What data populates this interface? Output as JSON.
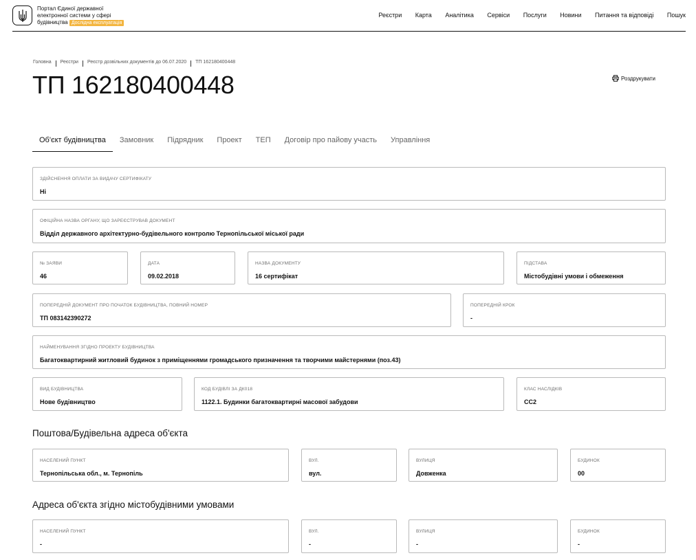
{
  "header": {
    "brand_line1": "Портал Єдиної державної",
    "brand_line2": "електронної системи у сфері",
    "brand_line3": "будівництва",
    "badge": "Дослідна експлуатація",
    "nav": [
      "Реєстри",
      "Карта",
      "Аналітика",
      "Сервіси",
      "Послуги",
      "Новини",
      "Питання та відповіді",
      "Пошук"
    ]
  },
  "breadcrumb": [
    "Головна",
    "Реєстри",
    "Реєстр дозвільних документів до 06.07.2020",
    "ТП 162180400448"
  ],
  "title": "ТП 162180400448",
  "print_label": "Роздрукувати",
  "tabs": [
    "Об'єкт будівництва",
    "Замовник",
    "Підрядник",
    "Проект",
    "ТЕП",
    "Договір про пайову участь",
    "Управління"
  ],
  "active_tab": 0,
  "fields": {
    "payment": {
      "label": "Здійснення оплати за видачу сертифікату",
      "value": "Ні"
    },
    "authority": {
      "label": "Офіційна назва органу, що зареєстрував документ",
      "value": "Відділ державного архітектурно-будівельного контролю Тернопільської міської ради"
    },
    "app_no": {
      "label": "№ заяви",
      "value": "46"
    },
    "date": {
      "label": "Дата",
      "value": "09.02.2018"
    },
    "doc_name": {
      "label": "Назва документу",
      "value": "16 сертифікат"
    },
    "basis": {
      "label": "Підстава",
      "value": "Містобудівні умови і обмеження"
    },
    "prev_doc": {
      "label": "Попередній документ про початок будівництва, повний номер",
      "value": "ТП 083142390272"
    },
    "prev_step": {
      "label": "Попередній крок",
      "value": "-"
    },
    "project_name": {
      "label": "Найменування згідно проекту будівництва",
      "value": "Багатоквартирний житловий будинок з приміщеннями громадського призначення та творчими майстернями (поз.43)"
    },
    "build_type": {
      "label": "Вид будівництва",
      "value": "Нове будівництво"
    },
    "dk018": {
      "label": "Код будівлі за ДК018",
      "value": "1122.1. Будинки багатоквартирні масової забудови"
    },
    "cc_class": {
      "label": "Клас наслідків",
      "value": "СС2"
    }
  },
  "postal_section": {
    "title": "Поштова/Будівельна адреса об'єкта",
    "locality": {
      "label": "Населений пункт",
      "value": "Тернопільська обл., м. Тернопіль"
    },
    "street_type": {
      "label": "Вул.",
      "value": "вул."
    },
    "street": {
      "label": "Вулиця",
      "value": "Довженка"
    },
    "house": {
      "label": "Будинок",
      "value": "00"
    }
  },
  "planning_section": {
    "title": "Адреса об'єкта згідно містобудівними умовами",
    "locality": {
      "label": "Населений пункт",
      "value": "-"
    },
    "street_type": {
      "label": "Вул.",
      "value": "-"
    },
    "street": {
      "label": "Вулиця",
      "value": "-"
    },
    "house": {
      "label": "Будинок",
      "value": "-"
    }
  }
}
